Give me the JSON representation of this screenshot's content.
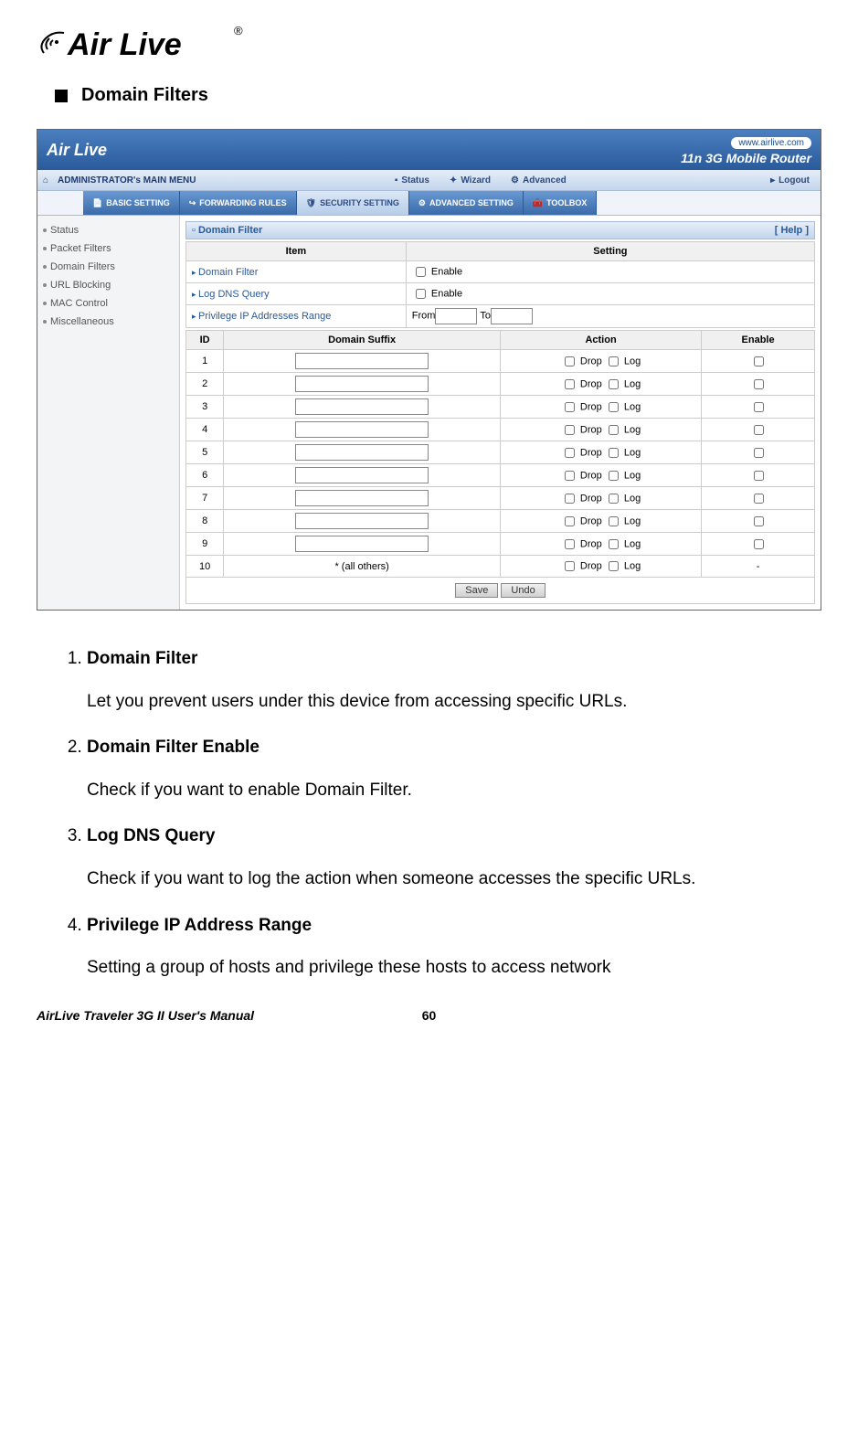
{
  "logo": "AirLive",
  "section_title": "Domain Filters",
  "screenshot": {
    "banner": {
      "logo": "Air Live",
      "url": "www.airlive.com",
      "subtitle": "11n 3G Mobile Router"
    },
    "menu1": {
      "title": "ADMINISTRATOR's MAIN MENU",
      "items": [
        "Status",
        "Wizard",
        "Advanced"
      ],
      "logout": "Logout"
    },
    "menu2": [
      "BASIC SETTING",
      "FORWARDING RULES",
      "SECURITY SETTING",
      "ADVANCED SETTING",
      "TOOLBOX"
    ],
    "sidebar": [
      "Status",
      "Packet Filters",
      "Domain Filters",
      "URL Blocking",
      "MAC Control",
      "Miscellaneous"
    ],
    "panel": {
      "title": "Domain Filter",
      "help": "[ Help ]",
      "headers1": [
        "Item",
        "Setting"
      ],
      "rows1": [
        {
          "label": "Domain Filter",
          "setting": "Enable",
          "type": "check"
        },
        {
          "label": "Log DNS Query",
          "setting": "Enable",
          "type": "check"
        },
        {
          "label": "Privilege IP Addresses Range",
          "from": "From",
          "to": "To",
          "type": "range"
        }
      ],
      "headers2": [
        "ID",
        "Domain Suffix",
        "Action",
        "Enable"
      ],
      "action_drop": "Drop",
      "action_log": "Log",
      "row_ids": [
        "1",
        "2",
        "3",
        "4",
        "5",
        "6",
        "7",
        "8",
        "9"
      ],
      "last_id": "10",
      "last_suffix": "* (all others)",
      "last_enable": "-",
      "save": "Save",
      "undo": "Undo"
    }
  },
  "descriptions": [
    {
      "term": "Domain Filter",
      "body": "Let you prevent users under this device from accessing specific URLs."
    },
    {
      "term": "Domain Filter Enable",
      "body": "Check if you want to enable Domain Filter."
    },
    {
      "term": "Log DNS Query",
      "body": "Check if you want to log the action when someone accesses the specific URLs."
    },
    {
      "term": "Privilege IP Address Range",
      "body": "Setting a group of hosts and privilege these hosts to access network"
    }
  ],
  "footer": {
    "manual": "AirLive Traveler 3G II User's Manual",
    "page": "60"
  }
}
